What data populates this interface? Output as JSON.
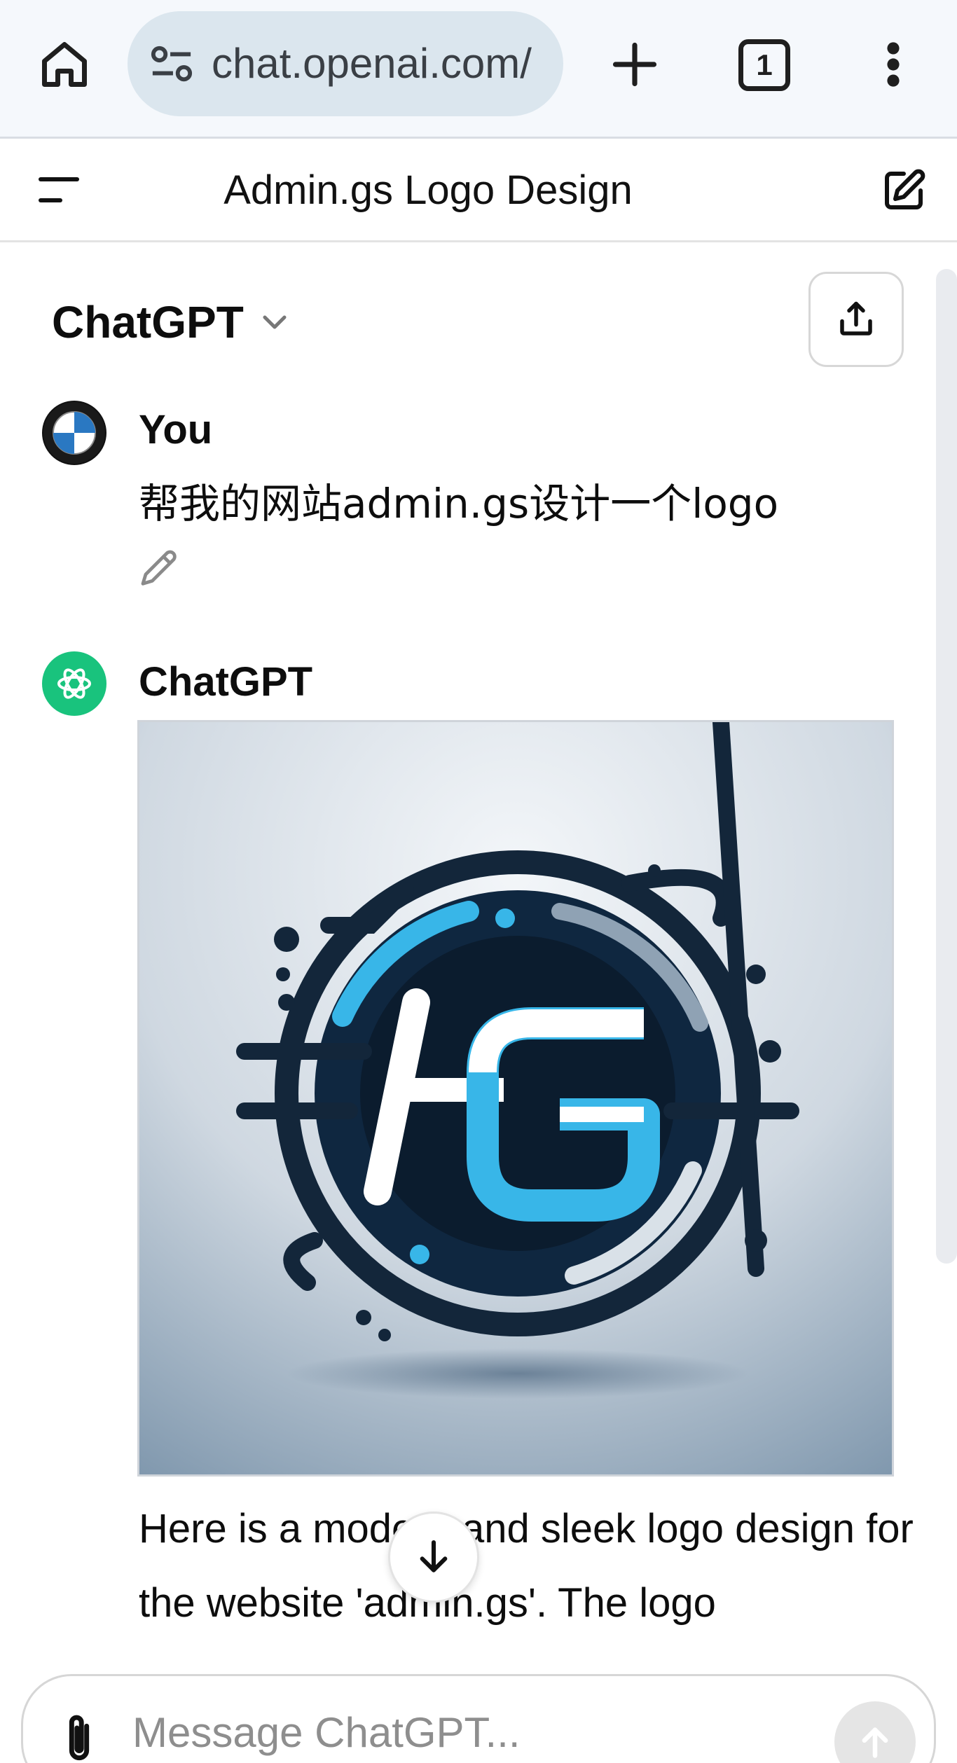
{
  "browser": {
    "url": "chat.openai.com/",
    "tab_count": "1",
    "icons": {
      "home": "home-icon",
      "site_info": "site-settings-icon",
      "new_tab": "plus-icon",
      "menu": "more-vertical-icon"
    }
  },
  "header": {
    "conversation_title": "Admin.gs Logo Design",
    "icons": {
      "sidebar": "sidebar-toggle-icon",
      "new_chat": "new-chat-icon"
    }
  },
  "model_selector": {
    "label": "ChatGPT",
    "icon": "chevron-down-icon"
  },
  "messages": [
    {
      "sender": "You",
      "text": "帮我的网站admin.gs设计一个logo",
      "avatar": "bmw-avatar"
    },
    {
      "sender": "ChatGPT",
      "image": "generated-logo-image",
      "text": "Here is a modern and sleek logo design for the website 'admin.gs'. The logo"
    }
  ],
  "composer": {
    "placeholder": "Message ChatGPT..."
  },
  "colors": {
    "accent_green": "#19c37d",
    "logo_navy": "#0f2740",
    "logo_cyan": "#38b6e8",
    "url_bar": "#dbe6ee"
  }
}
